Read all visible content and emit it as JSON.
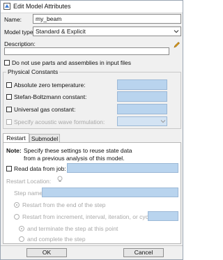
{
  "window": {
    "title": "Edit Model Attributes",
    "icon": "model-attributes-icon"
  },
  "fields": {
    "name_label": "Name:",
    "name_value": "my_beam",
    "model_type_label": "Model type:",
    "model_type_value": "Standard & Explicit",
    "description_label": "Description:",
    "description_value": ""
  },
  "do_not_use_parts_label": "Do not use parts and assemblies in input files",
  "physical_constants": {
    "group_label": "Physical Constants",
    "absolute_zero_label": "Absolute zero temperature:",
    "stefan_boltzmann_label": "Stefan-Boltzmann constant:",
    "universal_gas_label": "Universal gas constant:",
    "acoustic_wave_label": "Specify acoustic wave formulation:",
    "acoustic_wave_value": ""
  },
  "tabs": [
    {
      "label": "Restart"
    },
    {
      "label": "Submodel"
    }
  ],
  "restart": {
    "note_bold": "Note:",
    "note_line1": "Specify these settings to reuse state data",
    "note_line2": "from a previous analysis of this model.",
    "read_data_label": "Read data from job:",
    "restart_location_label": "Restart Location:",
    "step_name_label": "Step name:",
    "radio_end_label": "Restart from the end of the step",
    "radio_increment_label": "Restart from increment, interval, iteration, or cycle:",
    "radio_terminate_label": "and terminate the step at this point",
    "radio_complete_label": "and complete the step"
  },
  "buttons": {
    "ok": "OK",
    "cancel": "Cancel"
  },
  "colors": {
    "input_blue": "#b9d4ee",
    "pencil": "#e0a020"
  }
}
